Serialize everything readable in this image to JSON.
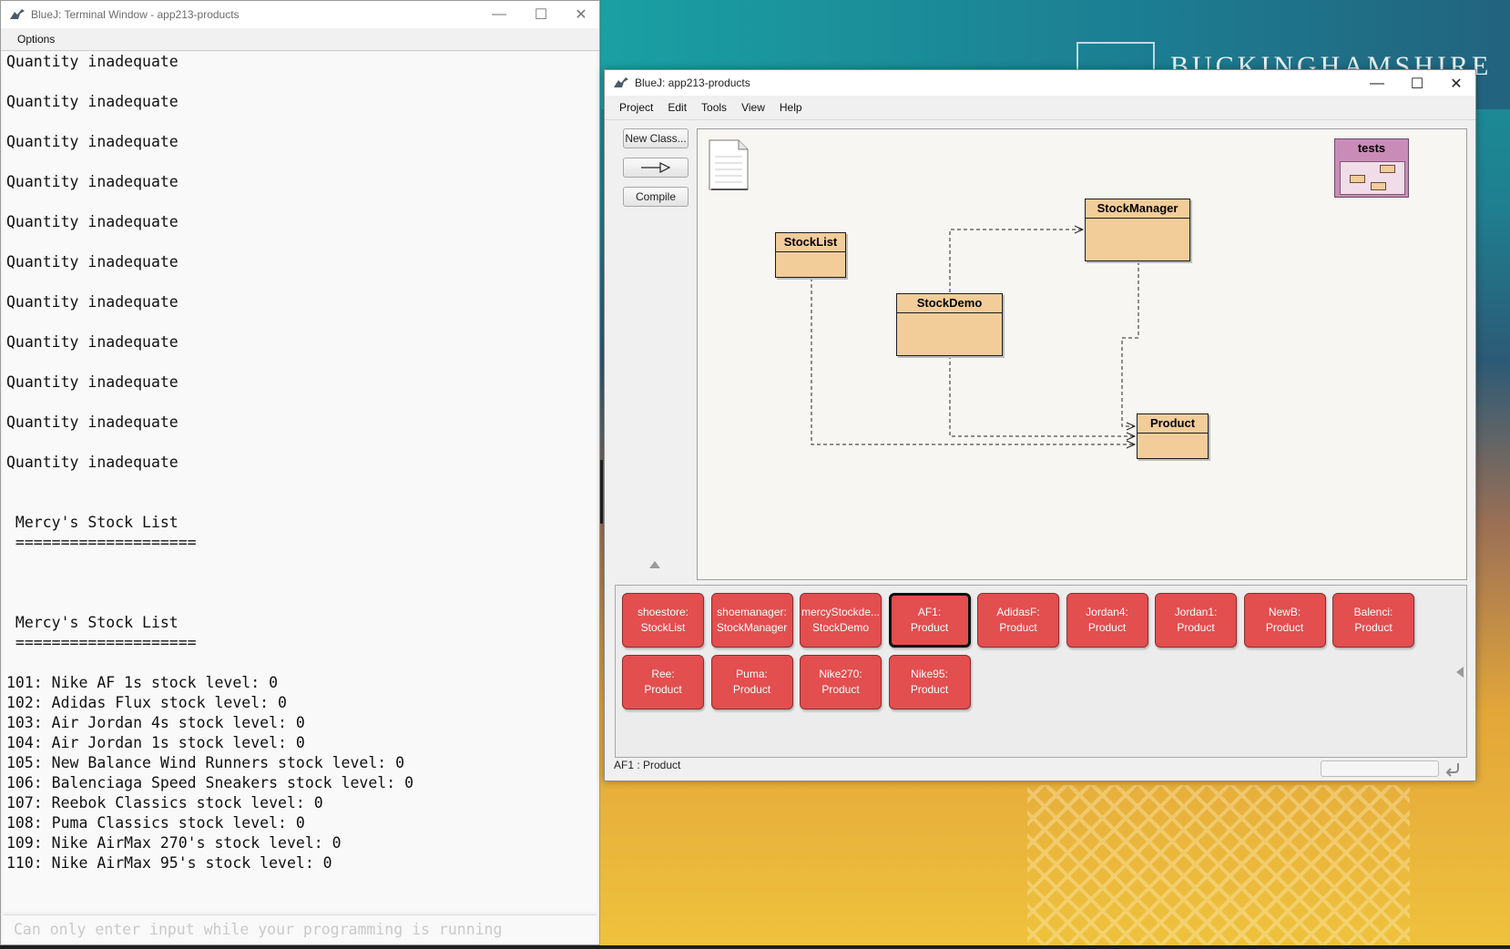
{
  "desktop": {
    "logo_text": "BUCKINGHAMSHIRE"
  },
  "terminal": {
    "title": "BlueJ: Terminal Window - app213-products",
    "menu": {
      "options": "Options"
    },
    "output_lines": [
      "Quantity inadequate",
      "",
      "Quantity inadequate",
      "",
      "Quantity inadequate",
      "",
      "Quantity inadequate",
      "",
      "Quantity inadequate",
      "",
      "Quantity inadequate",
      "",
      "Quantity inadequate",
      "",
      "Quantity inadequate",
      "",
      "Quantity inadequate",
      "",
      "Quantity inadequate",
      "",
      "Quantity inadequate",
      "",
      "",
      " Mercy's Stock List",
      " ====================",
      "",
      "",
      "",
      " Mercy's Stock List",
      " ====================",
      "",
      "101: Nike AF 1s stock level: 0",
      "102: Adidas Flux stock level: 0",
      "103: Air Jordan 4s stock level: 0",
      "104: Air Jordan 1s stock level: 0",
      "105: New Balance Wind Runners stock level: 0",
      "106: Balenciaga Speed Sneakers stock level: 0",
      "107: Reebok Classics stock level: 0",
      "108: Puma Classics stock level: 0",
      "109: Nike AirMax 270's stock level: 0",
      "110: Nike AirMax 95's stock level: 0"
    ],
    "input_placeholder": "Can only enter input while your programming is running"
  },
  "bluej": {
    "title": "BlueJ:  app213-products",
    "menu": [
      "Project",
      "Edit",
      "Tools",
      "View",
      "Help"
    ],
    "buttons": {
      "new_class": "New Class...",
      "compile": "Compile"
    },
    "classes": {
      "stocklist": "StockList",
      "stockmanager": "StockManager",
      "stockdemo": "StockDemo",
      "product": "Product"
    },
    "package": "tests",
    "objects": [
      {
        "name": "shoestore:",
        "type": "StockList"
      },
      {
        "name": "shoemanager:",
        "type": "StockManager"
      },
      {
        "name": "mercyStockde...",
        "type": "StockDemo"
      },
      {
        "name": "AF1:",
        "type": "Product",
        "selected": true
      },
      {
        "name": "AdidasF:",
        "type": "Product"
      },
      {
        "name": "Jordan4:",
        "type": "Product"
      },
      {
        "name": "Jordan1:",
        "type": "Product"
      },
      {
        "name": "NewB:",
        "type": "Product"
      },
      {
        "name": "Balenci:",
        "type": "Product"
      },
      {
        "name": "Ree:",
        "type": "Product"
      },
      {
        "name": "Puma:",
        "type": "Product"
      },
      {
        "name": "Nike270:",
        "type": "Product"
      },
      {
        "name": "Nike95:",
        "type": "Product"
      }
    ],
    "status": "AF1 : Product"
  },
  "colors": {
    "class_fill": "#f2cd9a",
    "object_fill": "#e34e4f",
    "package_fill": "#c98cb8"
  }
}
